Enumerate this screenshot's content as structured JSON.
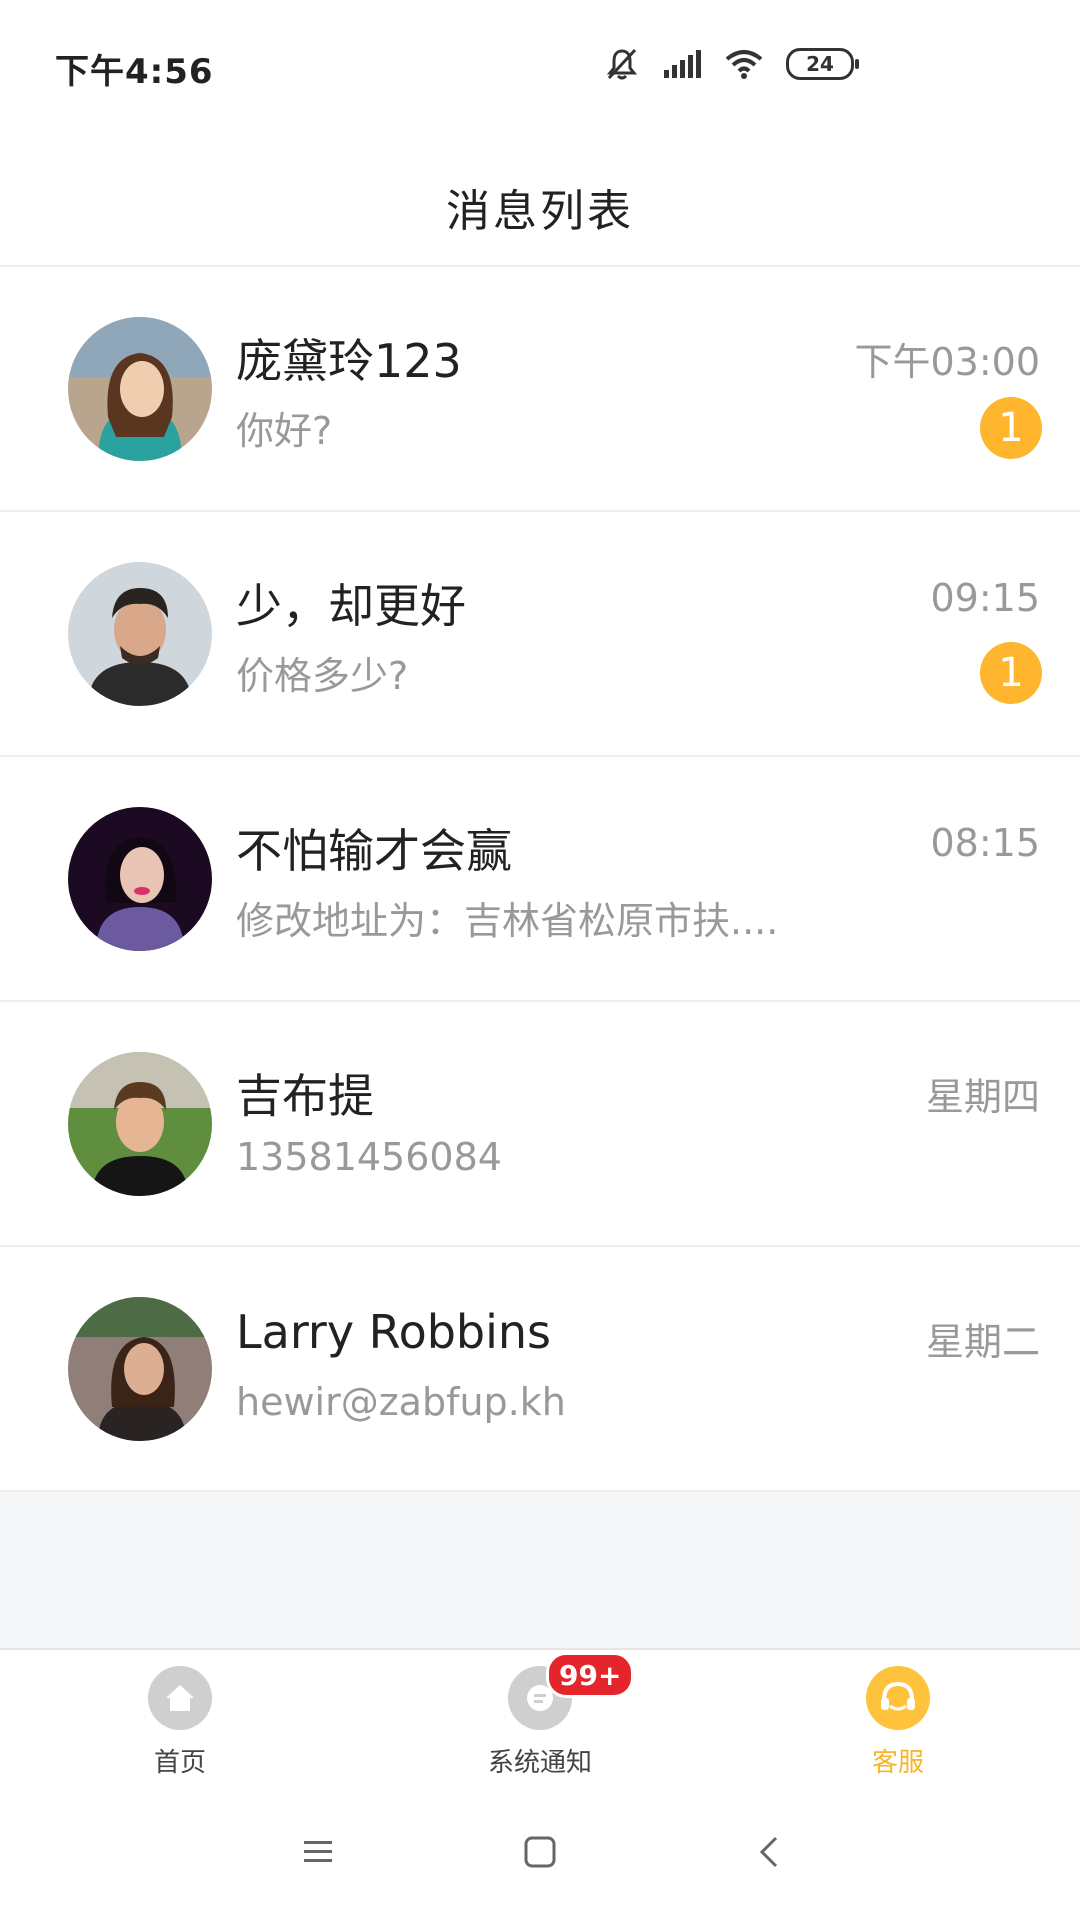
{
  "status_bar": {
    "time": "下午4:56",
    "battery": "24",
    "icons": [
      "mute-icon",
      "signal-icon",
      "wifi-icon",
      "battery-icon"
    ]
  },
  "header": {
    "title": "消息列表"
  },
  "colors": {
    "accent": "#ffb52e",
    "badge_red": "#e4262c",
    "text_primary": "#222222",
    "text_secondary": "#999999",
    "tab_inactive": "#cfcfcf"
  },
  "messages": [
    {
      "name": "庞黛玲123",
      "preview": "你好?",
      "time": "下午03:00",
      "unread": "1"
    },
    {
      "name": "少，却更好",
      "preview": "价格多少?",
      "time": "09:15",
      "unread": "1"
    },
    {
      "name": "不怕输才会赢",
      "preview": "修改地址为：吉林省松原市扶....",
      "time": "08:15",
      "unread": ""
    },
    {
      "name": "吉布提",
      "preview": "13581456084",
      "time": "星期四",
      "unread": ""
    },
    {
      "name": "Larry Robbins",
      "preview": "hewir@zabfup.kh",
      "time": "星期二",
      "unread": ""
    }
  ],
  "tabs": [
    {
      "label": "首页",
      "icon": "home-icon"
    },
    {
      "label": "系统通知",
      "icon": "message-icon",
      "badge": "99+"
    },
    {
      "label": "客服",
      "icon": "headset-icon",
      "active": true
    }
  ],
  "nav": [
    "menu-icon",
    "home-square-icon",
    "back-icon"
  ]
}
